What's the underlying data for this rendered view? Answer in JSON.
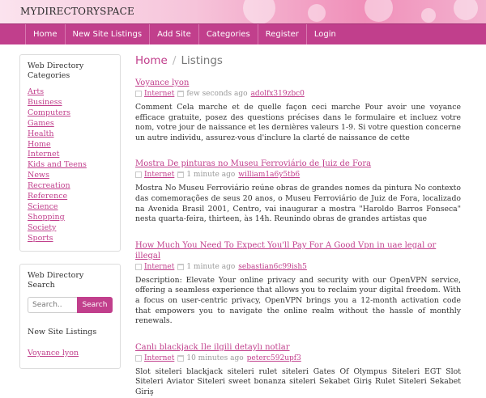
{
  "site": {
    "title": "MYDIRECTORYSPACE"
  },
  "nav": [
    "Home",
    "New Site Listings",
    "Add Site",
    "Categories",
    "Register",
    "Login"
  ],
  "sidebar": {
    "categories_title": "Web Directory Categories",
    "categories": [
      "Arts",
      "Business",
      "Computers",
      "Games",
      "Health",
      "Home",
      "Internet",
      "Kids and Teens",
      "News",
      "Recreation",
      "Reference",
      "Science",
      "Shopping",
      "Society",
      "Sports"
    ],
    "search_title": "Web Directory Search",
    "search_placeholder": "Search..",
    "search_button": "Search",
    "new_listings_title": "New Site Listings",
    "new_listings": [
      "Voyance lyon"
    ]
  },
  "breadcrumb": {
    "home": "Home",
    "sep": "/",
    "current": "Listings"
  },
  "listings": [
    {
      "title": "Voyance lyon",
      "category": "Internet",
      "time": "few seconds ago",
      "user": "adolfx319zbc0",
      "description": "Comment Cela marche et de quelle façon ceci marche Pour avoir une voyance efficace gratuite, posez des questions précises dans le formulaire et incluez votre nom, votre jour de naissance et les dernières valeurs 1-9. Si votre question concerne un autre individu, assurez-vous d'inclure la clarté de naissance de cette"
    },
    {
      "title": "Mostra De pinturas no Museu Ferroviário de Juiz de Fora",
      "category": "Internet",
      "time": "1 minute ago",
      "user": "william1a6y5tb6",
      "description": "Mostra No Museu Ferroviário reúne obras de grandes nomes da pintura No contexto das comemorações de seus 20 anos, o Museu Ferroviário de Juiz de Fora, localizado na Avenida Brasil 2001, Centro, vai inaugurar a mostra \"Haroldo Barros Fonseca\" nesta quarta-feira, thirteen, às 14h. Reunindo obras de grandes artistas que"
    },
    {
      "title": "How Much You Need To Expect You'll Pay For A Good Vpn in uae legal or illegal",
      "category": "Internet",
      "time": "1 minute ago",
      "user": "sebastian6c99ish5",
      "description": "Description: Elevate Your online privacy and security with our OpenVPN service, offering a seamless experience that allows you to reclaim your digital freedom. With a focus on user-centric privacy, OpenVPN brings you a 12-month activation code that empowers you to navigate the online realm without the hassle of monthly renewals."
    },
    {
      "title": "Canlı blackjack Ile ilgili detaylı notlar",
      "category": "Internet",
      "time": "10 minutes ago",
      "user": "peterc592upf3",
      "description": "Slot siteleri blackjack siteleri rulet siteleri Gates Of Olympus Siteleri EGT Slot Siteleri Aviator Siteleri sweet bonanza siteleri Sekabet Giriş Rulet Siteleri Sekabet Giriş"
    }
  ]
}
